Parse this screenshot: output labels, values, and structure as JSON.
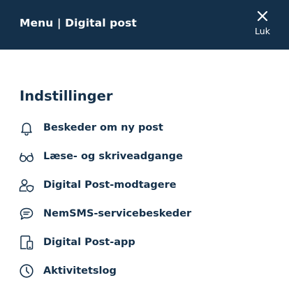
{
  "header": {
    "title": "Menu | Digital post",
    "close_label": "Luk",
    "background": "#14304a"
  },
  "settings": {
    "title": "Indstillinger",
    "items": [
      {
        "label": "Beskeder om ny post",
        "icon": "bell-icon"
      },
      {
        "label": "Læse- og skriveadgange",
        "icon": "glasses-icon"
      },
      {
        "label": "Digital Post-modtagere",
        "icon": "user-shield-icon"
      },
      {
        "label": "NemSMS-servicebeskeder",
        "icon": "chat-bubble-icon"
      },
      {
        "label": "Digital Post-app",
        "icon": "devices-icon"
      },
      {
        "label": "Aktivitetslog",
        "icon": "clock-icon"
      }
    ]
  },
  "colors": {
    "text": "#14304a",
    "accent": "#14304a"
  }
}
